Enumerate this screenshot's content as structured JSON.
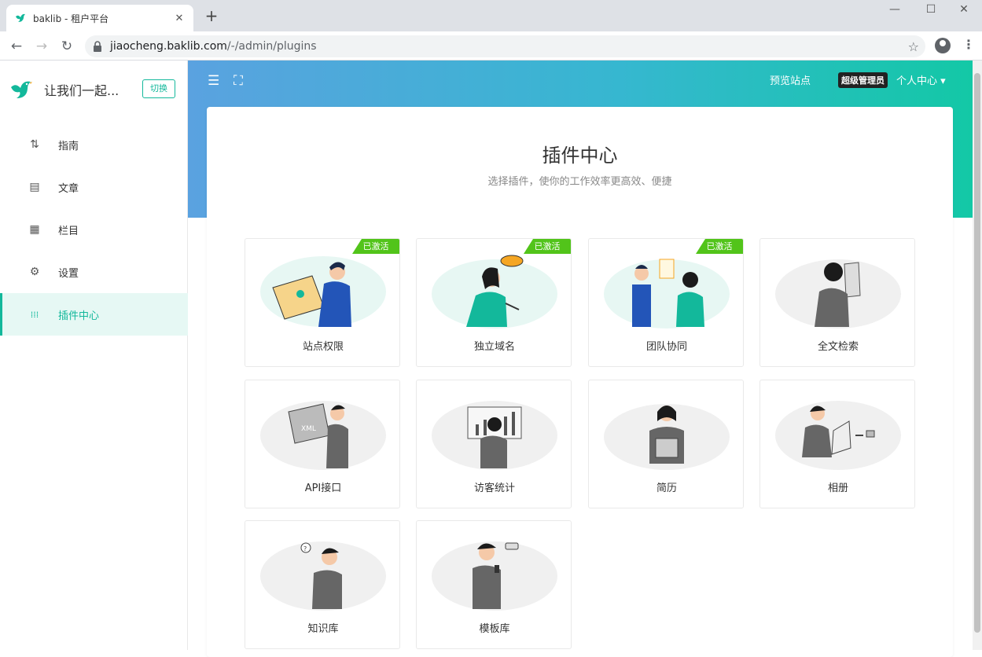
{
  "browser": {
    "tab_title": "baklib - 租户平台",
    "tab_close": "✕",
    "new_tab": "+",
    "url_host": "jiaocheng.baklib.com",
    "url_path": "/-/admin/plugins",
    "minimize": "—",
    "maximize": "☐",
    "close": "✕",
    "back": "←",
    "forward": "→",
    "reload": "↻",
    "star": "☆",
    "menu": "⋮"
  },
  "sidebar": {
    "brand_name": "让我们一起...",
    "switch_label": "切换",
    "items": [
      {
        "label": "指南",
        "icon": "signpost-icon",
        "glyph": "⇅"
      },
      {
        "label": "文章",
        "icon": "article-icon",
        "glyph": "▤"
      },
      {
        "label": "栏目",
        "icon": "grid-icon",
        "glyph": "▦"
      },
      {
        "label": "设置",
        "icon": "gear-icon",
        "glyph": "⚙"
      },
      {
        "label": "插件中心",
        "icon": "apps-icon",
        "glyph": "⁞⁞⁞",
        "active": true
      }
    ]
  },
  "header": {
    "list_icon": "☰",
    "fullscreen_icon": "⛶",
    "preview_label": "预览站点",
    "role_badge": "超级管理员",
    "user_center": "个人中心 ▾"
  },
  "panel": {
    "title": "插件中心",
    "subtitle": "选择插件，使你的工作效率更高效、便捷"
  },
  "plugins": [
    {
      "label": "站点权限",
      "badge": "已激活"
    },
    {
      "label": "独立域名",
      "badge": "已激活"
    },
    {
      "label": "团队协同",
      "badge": "已激活"
    },
    {
      "label": "全文检索",
      "badge": ""
    },
    {
      "label": "API接口",
      "badge": ""
    },
    {
      "label": "访客统计",
      "badge": ""
    },
    {
      "label": "简历",
      "badge": ""
    },
    {
      "label": "相册",
      "badge": ""
    },
    {
      "label": "知识库",
      "badge": ""
    },
    {
      "label": "模板库",
      "badge": ""
    }
  ],
  "colors": {
    "accent": "#13b89b",
    "badge": "#52c41a",
    "header_start": "#5aa2e0",
    "header_end": "#13c8a6"
  }
}
